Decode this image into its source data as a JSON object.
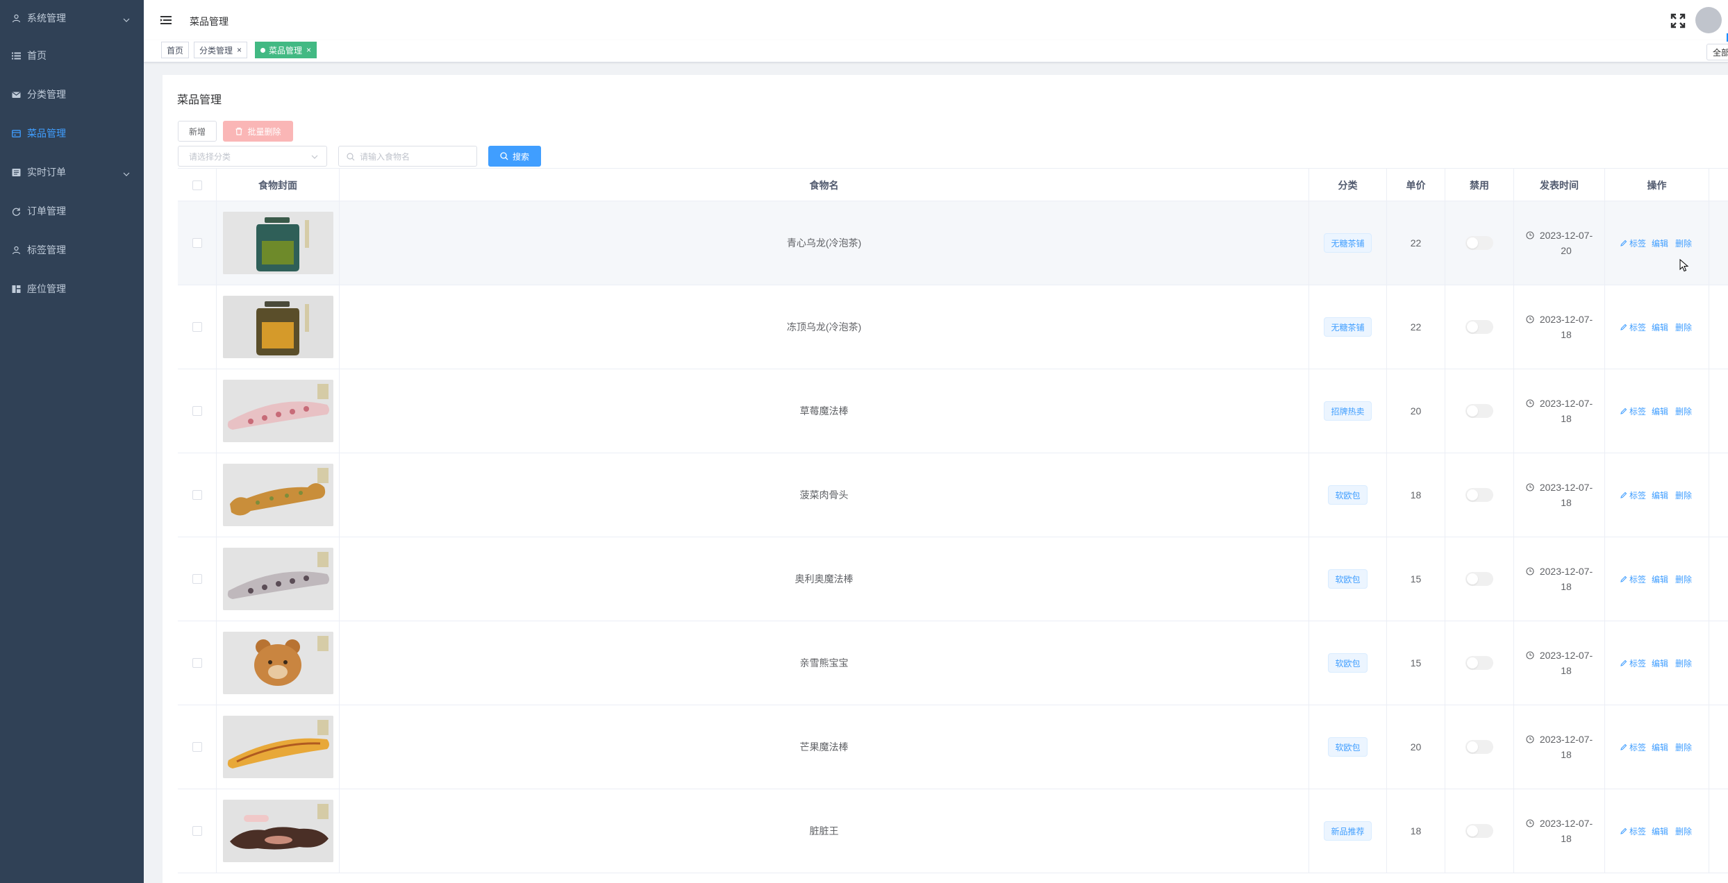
{
  "sidebar": {
    "items": [
      {
        "label": "系统管理",
        "icon": "user-icon",
        "has_children": true,
        "active": false
      },
      {
        "label": "首页",
        "icon": "list-icon",
        "has_children": false,
        "active": false
      },
      {
        "label": "分类管理",
        "icon": "mail-icon",
        "has_children": false,
        "active": false
      },
      {
        "label": "菜品管理",
        "icon": "card-icon",
        "has_children": false,
        "active": true
      },
      {
        "label": "实时订单",
        "icon": "orders-icon",
        "has_children": true,
        "active": false
      },
      {
        "label": "订单管理",
        "icon": "refresh-icon",
        "has_children": false,
        "active": false
      },
      {
        "label": "标签管理",
        "icon": "user-icon",
        "has_children": false,
        "active": false
      },
      {
        "label": "座位管理",
        "icon": "seat-icon",
        "has_children": false,
        "active": false
      }
    ],
    "colors": {
      "bg": "#304156",
      "text": "#bfcbd9",
      "active": "#409eff"
    }
  },
  "header": {
    "breadcrumb": "菜品管理",
    "icons": [
      "hamburger-icon",
      "fullscreen-icon",
      "avatar"
    ]
  },
  "tags": {
    "items": [
      {
        "label": "首页",
        "closable": false,
        "active": false
      },
      {
        "label": "分类管理",
        "closable": true,
        "active": false
      },
      {
        "label": "菜品管理",
        "closable": true,
        "active": true
      }
    ],
    "close_all": "全部",
    "close_glyph": "×",
    "active_color": "#42b983"
  },
  "main": {
    "title": "菜品管理",
    "add_button": "新增",
    "batch_delete_button": "批量删除",
    "category_select": {
      "placeholder": "请选择分类"
    },
    "search_input": {
      "placeholder": "请输入食物名"
    },
    "search_button": "搜索"
  },
  "table": {
    "columns": [
      "",
      "食物封面",
      "食物名",
      "分类",
      "单价",
      "禁用",
      "发表时间",
      "操作"
    ],
    "op_labels": {
      "tag": "标签",
      "edit": "编辑",
      "delete": "删除"
    },
    "rows": [
      {
        "name": "青心乌龙(冷泡茶)",
        "category": "无糖茶铺",
        "price": "22",
        "disabled": false,
        "date_line1": "2023-12-07-",
        "date_line2": "20",
        "cover": "bottle-green"
      },
      {
        "name": "冻顶乌龙(冷泡茶)",
        "category": "无糖茶铺",
        "price": "22",
        "disabled": false,
        "date_line1": "2023-12-07-",
        "date_line2": "18",
        "cover": "bottle-amber"
      },
      {
        "name": "草莓魔法棒",
        "category": "招牌热卖",
        "price": "20",
        "disabled": false,
        "date_line1": "2023-12-07-",
        "date_line2": "18",
        "cover": "baguette-pink"
      },
      {
        "name": "菠菜肉骨头",
        "category": "软欧包",
        "price": "18",
        "disabled": false,
        "date_line1": "2023-12-07-",
        "date_line2": "18",
        "cover": "bone-bread"
      },
      {
        "name": "奥利奥魔法棒",
        "category": "软欧包",
        "price": "15",
        "disabled": false,
        "date_line1": "2023-12-07-",
        "date_line2": "18",
        "cover": "baguette-dark"
      },
      {
        "name": "亲雪熊宝宝",
        "category": "软欧包",
        "price": "15",
        "disabled": false,
        "date_line1": "2023-12-07-",
        "date_line2": "18",
        "cover": "bear-bread"
      },
      {
        "name": "芒果魔法棒",
        "category": "软欧包",
        "price": "20",
        "disabled": false,
        "date_line1": "2023-12-07-",
        "date_line2": "18",
        "cover": "baguette-yellow"
      },
      {
        "name": "脏脏王",
        "category": "新品推荐",
        "price": "18",
        "disabled": false,
        "date_line1": "2023-12-07-",
        "date_line2": "18",
        "cover": "dirty-bread"
      }
    ]
  }
}
